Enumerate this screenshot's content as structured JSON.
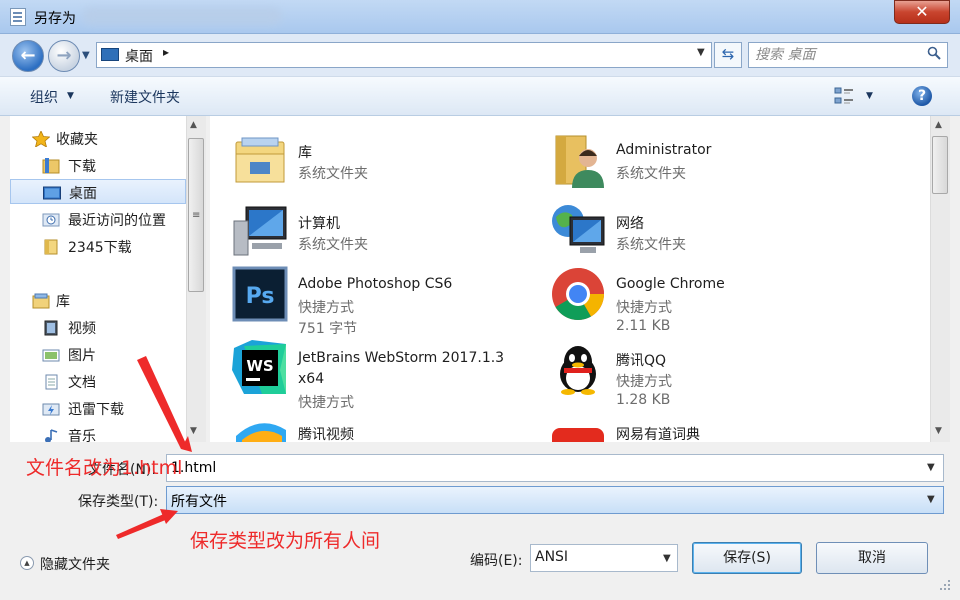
{
  "window": {
    "title": "另存为",
    "close_symbol": "✕"
  },
  "address": {
    "location": "桌面",
    "separator": "▸",
    "search_placeholder": "搜索 桌面"
  },
  "toolbar": {
    "organize": "组织",
    "new_folder": "新建文件夹",
    "help": "?"
  },
  "nav": {
    "favorites": "收藏夹",
    "downloads": "下载",
    "desktop": "桌面",
    "recent": "最近访问的位置",
    "downloads_2345": "2345下载",
    "libraries": "库",
    "videos": "视频",
    "pictures": "图片",
    "documents": "文档",
    "thunder": "迅雷下载",
    "music": "音乐"
  },
  "files": [
    {
      "name": "库",
      "type": "系统文件夹",
      "size": "",
      "icon": "library-folder-icon"
    },
    {
      "name": "Administrator",
      "type": "系统文件夹",
      "size": "",
      "icon": "user-folder-icon"
    },
    {
      "name": "计算机",
      "type": "系统文件夹",
      "size": "",
      "icon": "computer-icon"
    },
    {
      "name": "网络",
      "type": "系统文件夹",
      "size": "",
      "icon": "network-icon"
    },
    {
      "name": "Adobe Photoshop CS6",
      "type": "快捷方式",
      "size": "751 字节",
      "icon": "photoshop-icon"
    },
    {
      "name": "Google Chrome",
      "type": "快捷方式",
      "size": "2.11 KB",
      "icon": "chrome-icon"
    },
    {
      "name": "JetBrains WebStorm 2017.1.3",
      "name2": "x64",
      "type": "快捷方式",
      "size": "",
      "icon": "webstorm-icon"
    },
    {
      "name": "腾讯QQ",
      "type": "快捷方式",
      "size": "1.28 KB",
      "icon": "qq-icon"
    },
    {
      "name": "腾讯视频",
      "type": "",
      "size": "",
      "icon": "tencent-video-icon"
    },
    {
      "name": "网易有道词典",
      "type": "",
      "size": "",
      "icon": "youdao-icon"
    }
  ],
  "form": {
    "filename_label": "文件名(N):",
    "filename_value": "1.html",
    "savetype_label": "保存类型(T):",
    "savetype_value": "所有文件",
    "hide_folders": "隐藏文件夹",
    "encoding_label": "编码(E):",
    "encoding_value": "ANSI",
    "save": "保存(S)",
    "cancel": "取消"
  },
  "annotations": {
    "filename_note": "文件名改为1.html",
    "savetype_note": "保存类型改为所有人间"
  },
  "colors": {
    "annotation": "#ee2a2a",
    "selection": "#d4e5fa"
  }
}
